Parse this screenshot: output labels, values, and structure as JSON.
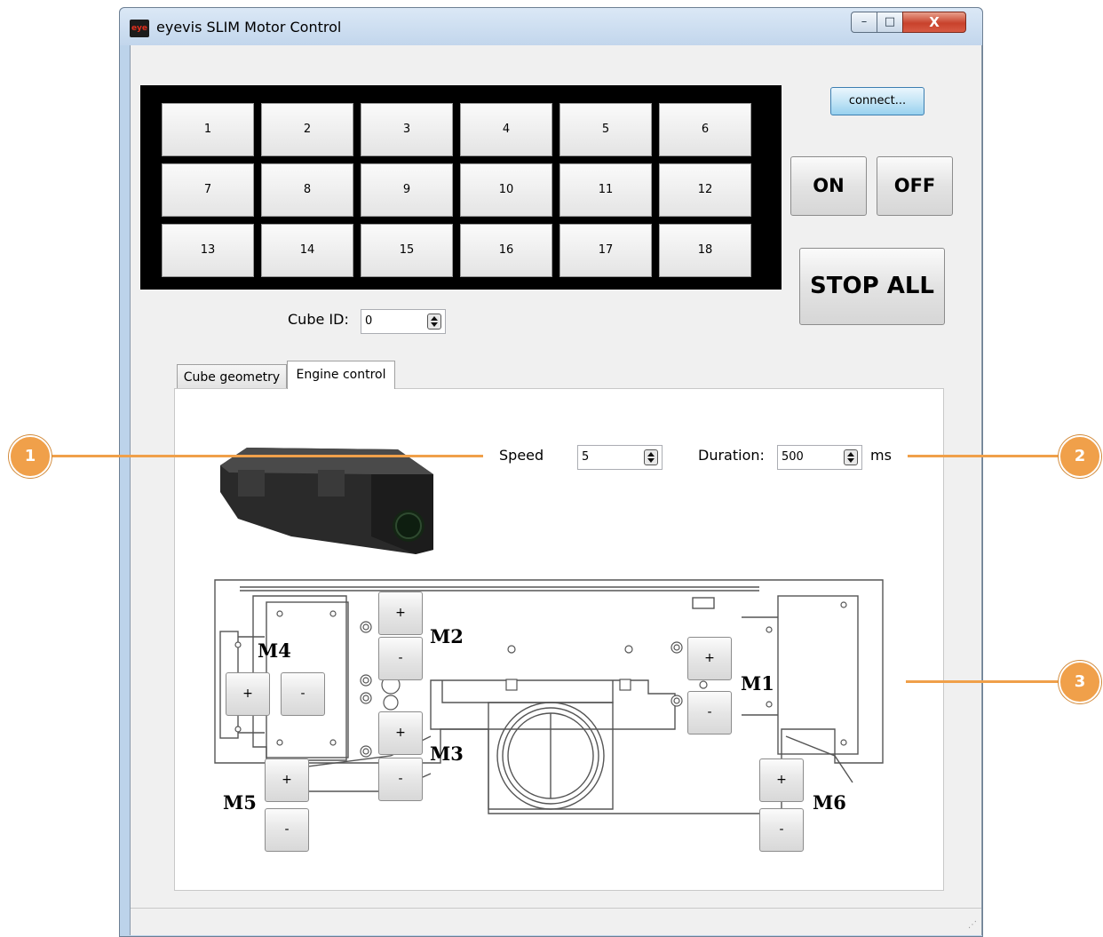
{
  "window": {
    "title": "eyevis SLIM Motor Control",
    "app_icon_text": "eye",
    "minimize_glyph": "–",
    "maximize_glyph": "□",
    "close_glyph": "X"
  },
  "cubes": [
    "1",
    "2",
    "3",
    "4",
    "5",
    "6",
    "7",
    "8",
    "9",
    "10",
    "11",
    "12",
    "13",
    "14",
    "15",
    "16",
    "17",
    "18"
  ],
  "controls": {
    "connect_label": "connect...",
    "on_label": "ON",
    "off_label": "OFF",
    "stop_all_label": "STOP ALL",
    "cube_id_label": "Cube ID:",
    "cube_id_value": "0"
  },
  "tabs": [
    {
      "label": "Cube geometry",
      "selected": false
    },
    {
      "label": "Engine control",
      "selected": true
    }
  ],
  "engine": {
    "speed_label": "Speed",
    "speed_value": "5",
    "duration_label": "Duration:",
    "duration_value": "500",
    "duration_unit": "ms"
  },
  "motors": {
    "plus": "+",
    "minus": "-",
    "m1": "M1",
    "m2": "M2",
    "m3": "M3",
    "m4": "M4",
    "m5": "M5",
    "m6": "M6"
  },
  "callouts": [
    "1",
    "2",
    "3"
  ],
  "colors": {
    "accent": "#f0a04a",
    "cube_panel_bg": "#000000",
    "close_button": "#c8422c"
  }
}
